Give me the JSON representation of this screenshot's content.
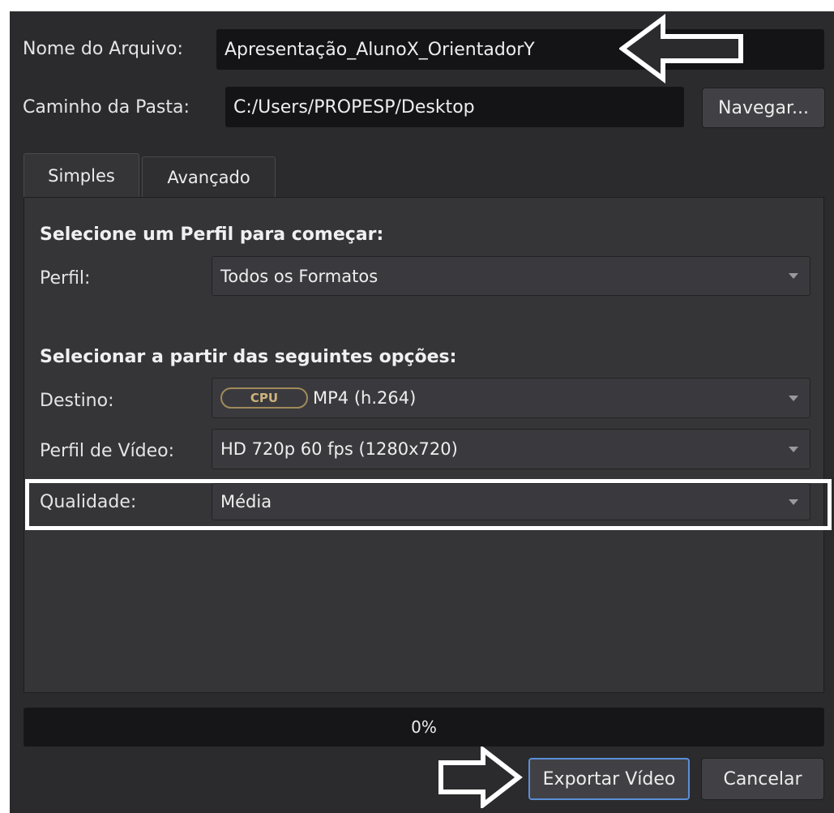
{
  "file": {
    "label": "Nome do Arquivo:",
    "value": "Apresentação_AlunoX_OrientadorY"
  },
  "folder": {
    "label": "Caminho da Pasta:",
    "value": "C:/Users/PROPESP/Desktop",
    "browse_label": "Navegar..."
  },
  "tabs": [
    {
      "label": "Simples",
      "active": true
    },
    {
      "label": "Avançado",
      "active": false
    }
  ],
  "simple": {
    "profile_heading": "Selecione um Perfil para começar:",
    "profile": {
      "label": "Perfil:",
      "value": "Todos os Formatos"
    },
    "options_heading": "Selecionar a partir das seguintes opções:",
    "target": {
      "label": "Destino:",
      "badge": "CPU",
      "value": "MP4 (h.264)"
    },
    "video_profile": {
      "label": "Perfil de Vídeo:",
      "value": "HD 720p 60 fps (1280x720)"
    },
    "quality": {
      "label": "Qualidade:",
      "value": "Média"
    }
  },
  "progress": {
    "text": "0%",
    "fraction": 0.0
  },
  "buttons": {
    "export": "Exportar Vídeo",
    "cancel": "Cancelar"
  },
  "colors": {
    "annotation": "#ffffff",
    "badge_gold": "#a08a5a",
    "dialog_bg": "#2b2b2d"
  }
}
